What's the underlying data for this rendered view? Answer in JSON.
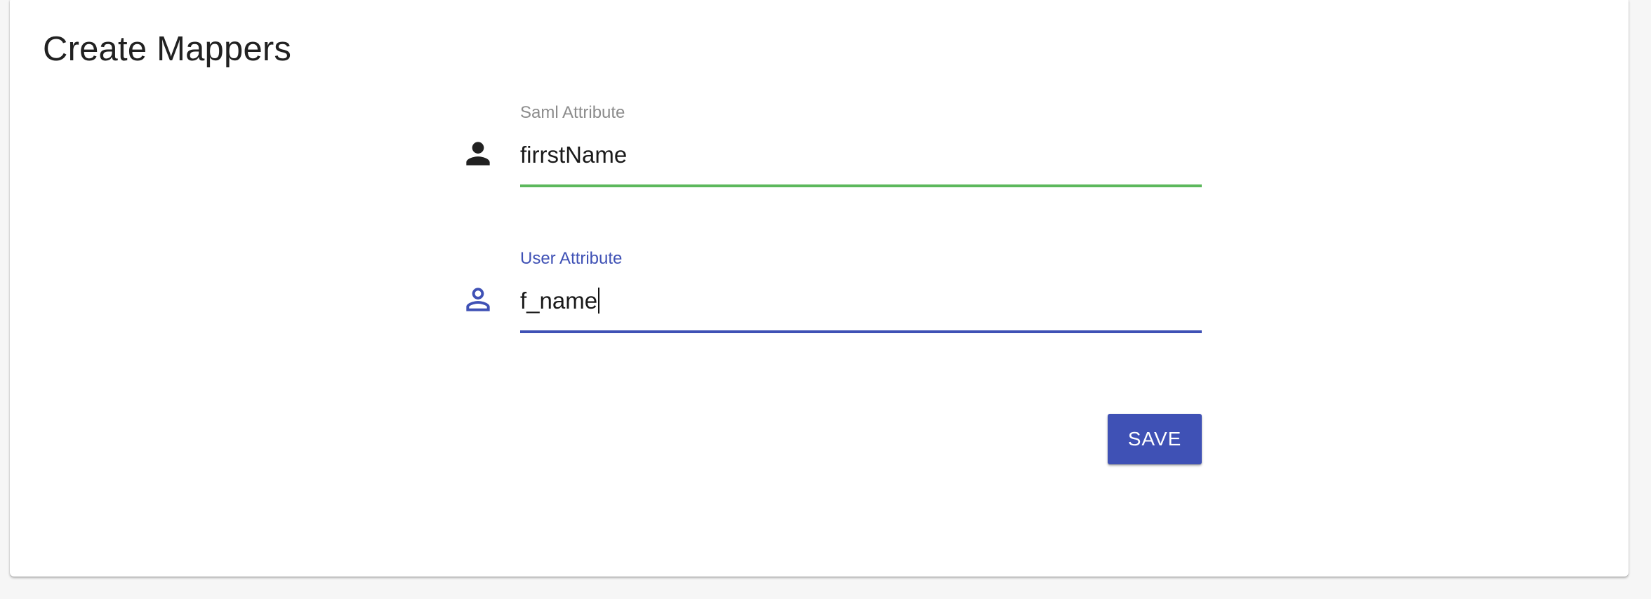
{
  "page": {
    "title": "Create Mappers"
  },
  "form": {
    "saml_attribute": {
      "label": "Saml Attribute",
      "value": "firrstName",
      "icon": "person-filled-icon",
      "underline_color": "#5cb85c",
      "label_color": "#8c8c8c"
    },
    "user_attribute": {
      "label": "User Attribute",
      "value": "f_name",
      "icon": "person-outline-icon",
      "underline_color": "#3f51b5",
      "label_color": "#3f51b5",
      "focused": true
    },
    "save_button": {
      "label": "SAVE",
      "color": "#3f51b5"
    }
  }
}
